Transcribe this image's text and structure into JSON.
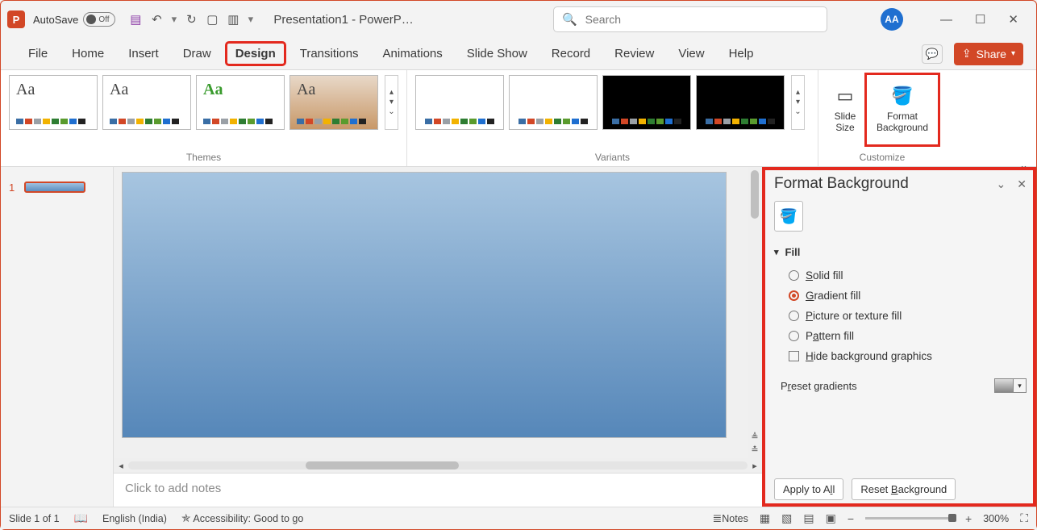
{
  "title": "Presentation1 - PowerP…",
  "autosave": {
    "label": "AutoSave",
    "state": "Off"
  },
  "search": {
    "placeholder": "Search"
  },
  "user": {
    "initials": "AA"
  },
  "tabs": [
    "File",
    "Home",
    "Insert",
    "Draw",
    "Design",
    "Transitions",
    "Animations",
    "Slide Show",
    "Record",
    "Review",
    "View",
    "Help"
  ],
  "share": "Share",
  "ribbon": {
    "themes_label": "Themes",
    "variants_label": "Variants",
    "customize_label": "Customize",
    "slide_size": "Slide\nSize",
    "format_bg": "Format\nBackground"
  },
  "thumb": {
    "num": "1"
  },
  "notes_placeholder": "Click to add notes",
  "taskpane": {
    "title": "Format Background",
    "fill": "Fill",
    "solid": "Solid fill",
    "gradient": "Gradient fill",
    "picture": "Picture or texture fill",
    "pattern": "Pattern fill",
    "hide": "Hide background graphics",
    "preset": "Preset gradients",
    "apply": "Apply to All",
    "reset": "Reset Background"
  },
  "status": {
    "slide": "Slide 1 of 1",
    "lang": "English (India)",
    "access": "Accessibility: Good to go",
    "notesbtn": "Notes",
    "zoom": "300%"
  },
  "swatch_colors": [
    "#3a6ea5",
    "#d24726",
    "#9aa0a6",
    "#f2b200",
    "#2e7d32",
    "#5a9b2e",
    "#1f6fd0",
    "#222"
  ]
}
